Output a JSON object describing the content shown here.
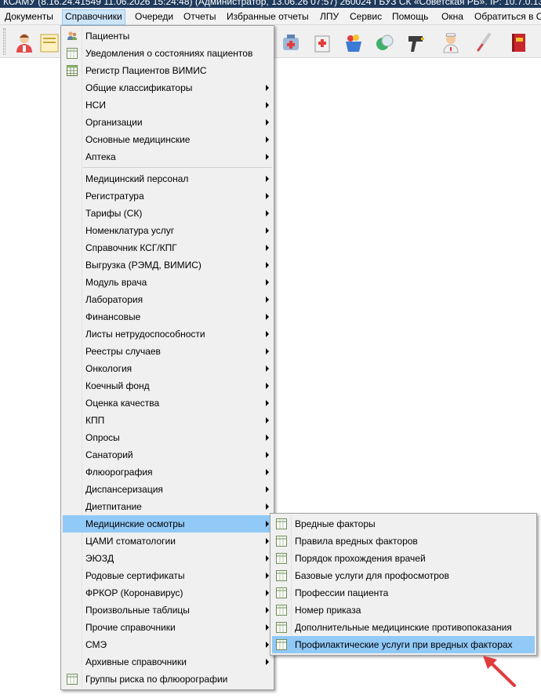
{
  "window": {
    "title": "КСАМУ (8.16.24.41549 11.06.2026 15:24:48) (Администратор, 13.06.26 07:57) 260024 ГБУЗ СК «Советская РБ». IP: 10.7.0.13"
  },
  "menubar": {
    "items": [
      "Документы",
      "Справочники",
      "Очереди",
      "Отчеты",
      "Избранные отчеты",
      "ЛПУ",
      "Сервис",
      "Помощь",
      "Окна",
      "Обратиться в О"
    ],
    "active": "Справочники"
  },
  "toolbar": {
    "icons": [
      "doctor-icon",
      "patient-card-icon",
      "pharmacy-icon",
      "medical-kit-icon",
      "medicine-basket-icon",
      "pills-icon",
      "barcode-scanner-icon",
      "nurse-icon",
      "thermometer-icon",
      "red-book-icon"
    ]
  },
  "main_menu": {
    "items": [
      {
        "label": "Пациенты",
        "icon": "patients-icon",
        "submenu": false
      },
      {
        "label": "Уведомления о состояниях пациентов",
        "icon": "table-icon",
        "submenu": false
      },
      {
        "label": "Регистр Пациентов ВИМИС",
        "icon": "grid-icon",
        "submenu": false
      },
      {
        "label": "Общие классификаторы",
        "submenu": true
      },
      {
        "label": "НСИ",
        "submenu": true
      },
      {
        "label": "Организации",
        "submenu": true
      },
      {
        "label": "Основные медицинские",
        "submenu": true
      },
      {
        "label": "Аптека",
        "submenu": true
      },
      {
        "label": "Медицинский персонал",
        "submenu": true
      },
      {
        "label": "Регистратура",
        "submenu": true
      },
      {
        "label": "Тарифы (СК)",
        "submenu": true
      },
      {
        "label": "Номенклатура услуг",
        "submenu": true
      },
      {
        "label": "Справочник КСГ/КПГ",
        "submenu": true
      },
      {
        "label": "Выгрузка (РЭМД, ВИМИС)",
        "submenu": true
      },
      {
        "label": "Модуль врача",
        "submenu": true
      },
      {
        "label": "Лаборатория",
        "submenu": true
      },
      {
        "label": "Финансовые",
        "submenu": true
      },
      {
        "label": "Листы нетрудоспособности",
        "submenu": true
      },
      {
        "label": "Реестры случаев",
        "submenu": true
      },
      {
        "label": "Онкология",
        "submenu": true
      },
      {
        "label": "Коечный фонд",
        "submenu": true
      },
      {
        "label": "Оценка качества",
        "submenu": true
      },
      {
        "label": "КПП",
        "submenu": true
      },
      {
        "label": "Опросы",
        "submenu": true
      },
      {
        "label": "Санаторий",
        "submenu": true
      },
      {
        "label": "Флюорография",
        "submenu": true
      },
      {
        "label": "Диспансеризация",
        "submenu": true
      },
      {
        "label": "Диетпитание",
        "submenu": true
      },
      {
        "label": "Медицинские осмотры",
        "submenu": true,
        "highlighted": true
      },
      {
        "label": "ЦАМИ стоматологии",
        "submenu": true
      },
      {
        "label": "ЭЮЗД",
        "submenu": true
      },
      {
        "label": "Родовые сертификаты",
        "submenu": true
      },
      {
        "label": "ФРКОР (Коронавирус)",
        "submenu": true
      },
      {
        "label": "Произвольные таблицы",
        "submenu": true
      },
      {
        "label": "Прочие справочники",
        "submenu": true
      },
      {
        "label": "СМЭ",
        "submenu": true
      },
      {
        "label": "Архивные справочники",
        "submenu": true
      },
      {
        "label": "Группы риска по флюорографии",
        "icon": "table-icon",
        "submenu": false
      }
    ]
  },
  "sub_menu": {
    "items": [
      {
        "label": "Вредные факторы"
      },
      {
        "label": "Правила вредных факторов"
      },
      {
        "label": "Порядок прохождения врачей"
      },
      {
        "label": "Базовые услуги для профосмотров"
      },
      {
        "label": "Профессии пациента"
      },
      {
        "label": "Номер приказа"
      },
      {
        "label": "Дополнительные медицинские противопоказания"
      },
      {
        "label": "Профилактические услуги при вредных факторах",
        "highlighted": true
      }
    ]
  },
  "colors": {
    "menu_bg": "#f0f0f0",
    "highlight": "#91c9f7",
    "menubar_active": "#cce4f7",
    "annotation_arrow": "#e03b3b"
  }
}
